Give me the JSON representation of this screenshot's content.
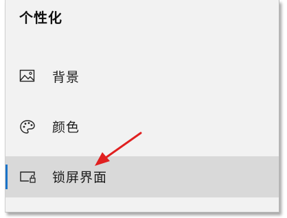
{
  "page_title": "个性化",
  "nav": {
    "items": [
      {
        "label": "背景",
        "icon": "picture-icon"
      },
      {
        "label": "颜色",
        "icon": "palette-icon"
      },
      {
        "label": "锁屏界面",
        "icon": "lock-screen-icon",
        "selected": true
      }
    ]
  },
  "colors": {
    "selected_background": "#d9d9d9",
    "selected_indicator": "#1a73c8",
    "annotation_arrow": "#e02020"
  }
}
